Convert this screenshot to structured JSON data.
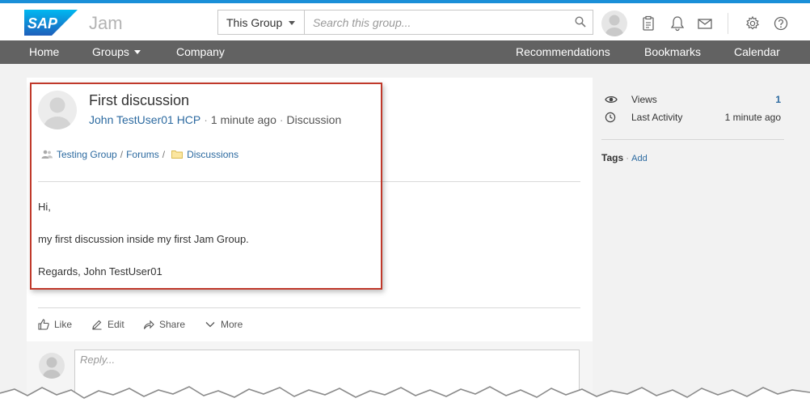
{
  "header": {
    "logo_text": "SAP",
    "app_name": "Jam",
    "scope_label": "This Group",
    "search_placeholder": "Search this group..."
  },
  "nav": {
    "home": "Home",
    "groups": "Groups",
    "company": "Company",
    "recommendations": "Recommendations",
    "bookmarks": "Bookmarks",
    "calendar": "Calendar"
  },
  "post": {
    "title": "First discussion",
    "author": "John TestUser01 HCP",
    "time": "1 minute ago",
    "type": "Discussion",
    "breadcrumb": {
      "group": "Testing Group",
      "forums": "Forums",
      "folder": "Discussions"
    },
    "body": {
      "line1": "Hi,",
      "line2": "my first discussion inside my first Jam Group.",
      "line3": "Regards, John TestUser01"
    },
    "actions": {
      "like": "Like",
      "edit": "Edit",
      "share": "Share",
      "more": "More"
    },
    "reply_placeholder": "Reply..."
  },
  "sidebar": {
    "views_label": "Views",
    "views_value": "1",
    "last_activity_label": "Last Activity",
    "last_activity_value": "1 minute ago",
    "tags_label": "Tags",
    "tags_add": "Add"
  },
  "colors": {
    "accent_top": "#1a8fd8",
    "nav_bg": "#626262",
    "link": "#2c6aa0",
    "highlight": "#c0392b"
  }
}
